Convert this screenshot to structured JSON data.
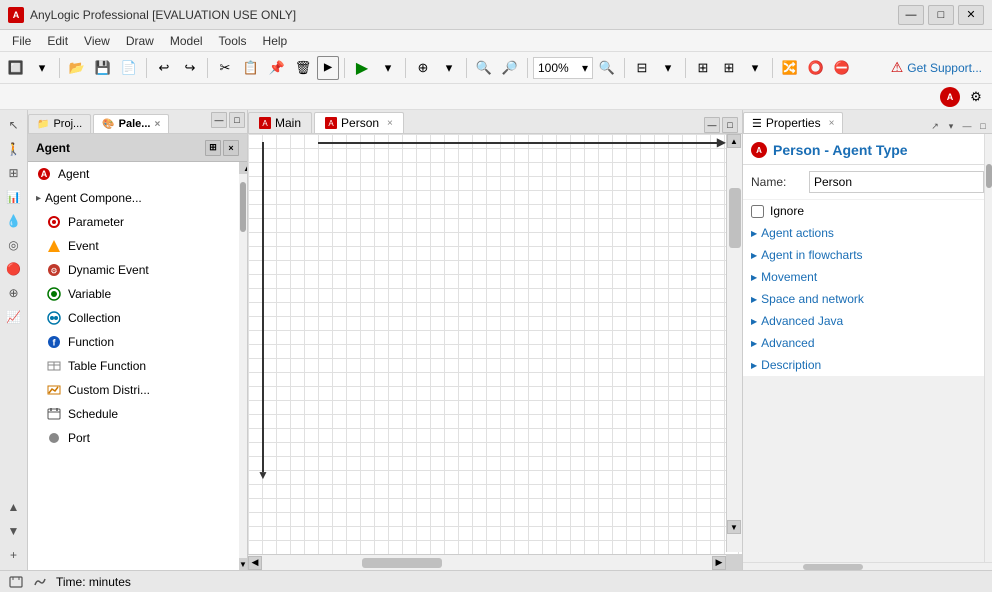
{
  "app": {
    "title": "AnyLogic Professional [EVALUATION USE ONLY]",
    "logo": "A"
  },
  "title_controls": {
    "minimize": "—",
    "maximize": "□",
    "close": "✕"
  },
  "menu": {
    "items": [
      "File",
      "Edit",
      "View",
      "Draw",
      "Model",
      "Tools",
      "Help"
    ]
  },
  "toolbar": {
    "zoom_label": "100%",
    "get_support": "Get Support..."
  },
  "left_panel": {
    "tabs": [
      {
        "id": "proj",
        "label": "Proj...",
        "active": false
      },
      {
        "id": "pale",
        "label": "Pale...",
        "active": true
      }
    ],
    "palette_header": "Agent",
    "items": [
      {
        "icon": "🔵",
        "label": "Agent",
        "indent": 0,
        "icon_color": "#c00"
      },
      {
        "icon": "▸",
        "label": "Agent Compone...",
        "indent": 1,
        "icon_color": "#555"
      },
      {
        "icon": "🔴",
        "label": "Parameter",
        "indent": 2,
        "icon_color": "#c00"
      },
      {
        "icon": "⚡",
        "label": "Event",
        "indent": 2,
        "icon_color": "#f90"
      },
      {
        "icon": "⚙",
        "label": "Dynamic Event",
        "indent": 2,
        "icon_color": "#e05"
      },
      {
        "icon": "📊",
        "label": "Variable",
        "indent": 2,
        "icon_color": "#070"
      },
      {
        "icon": "🔷",
        "label": "Collection",
        "indent": 2,
        "icon_color": "#07a"
      },
      {
        "icon": "🔵",
        "label": "Function",
        "indent": 2,
        "icon_color": "#15b"
      },
      {
        "icon": "📋",
        "label": "Table Function",
        "indent": 2,
        "icon_color": "#888"
      },
      {
        "icon": "📈",
        "label": "Custom Distri...",
        "indent": 2,
        "icon_color": "#c70"
      },
      {
        "icon": "📅",
        "label": "Schedule",
        "indent": 2,
        "icon_color": "#555"
      },
      {
        "icon": "●",
        "label": "Port",
        "indent": 2,
        "icon_color": "#888"
      }
    ]
  },
  "canvas": {
    "tabs": [
      {
        "id": "main",
        "label": "Main",
        "active": false
      },
      {
        "id": "person",
        "label": "Person",
        "active": true
      }
    ]
  },
  "properties": {
    "tab_label": "Properties",
    "title": "Person - Agent Type",
    "name_label": "Name:",
    "name_value": "Person",
    "ignore_label": "Ignore",
    "sections": [
      "Agent actions",
      "Agent in flowcharts",
      "Movement",
      "Space and network",
      "Advanced Java",
      "Advanced",
      "Description"
    ]
  },
  "status_bar": {
    "time_label": "Time: minutes"
  },
  "icons": {
    "search": "🔍",
    "run": "▶",
    "stop": "■",
    "project": "📁",
    "palette": "🎨",
    "grid": "⊞",
    "zoom_in": "+",
    "zoom_out": "−",
    "arrow_up": "▲",
    "arrow_down": "▼",
    "arrow_left": "◀",
    "arrow_right": "▶",
    "close": "×",
    "minimize": "—",
    "maximize": "□",
    "pin": "📌",
    "settings": "⚙"
  }
}
